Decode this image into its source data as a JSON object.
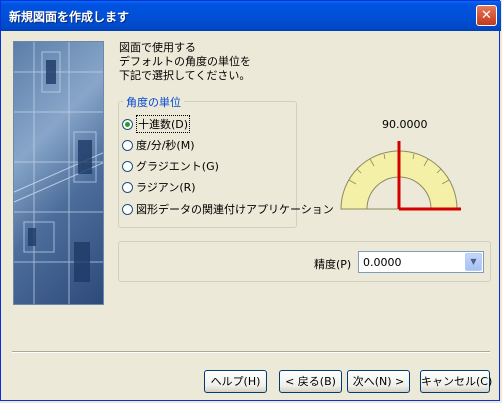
{
  "window": {
    "title": "新規図面を作成します",
    "close_glyph": "✕"
  },
  "description": "図面で使用する\nデフォルトの角度の単位を\n下記で選択してください。",
  "angle_units": {
    "group_label": "角度の単位",
    "options": [
      {
        "label": "十進数(D)",
        "checked": true
      },
      {
        "label": "度/分/秒(M)",
        "checked": false
      },
      {
        "label": "グラジエント(G)",
        "checked": false
      },
      {
        "label": "ラジアン(R)",
        "checked": false
      },
      {
        "label": "図形データの関連付けアプリケーション",
        "checked": false
      }
    ]
  },
  "preview": {
    "angle_value": "90.0000",
    "colors": {
      "protractor_fill": "#f5f0a8",
      "direction_line": "#d40000"
    }
  },
  "precision": {
    "label": "精度(P)",
    "value": "0.0000"
  },
  "buttons": {
    "help": "ヘルプ(H)",
    "back": "< 戻る(B)",
    "next": "次へ(N) >",
    "cancel": "キャンセル(C)"
  }
}
